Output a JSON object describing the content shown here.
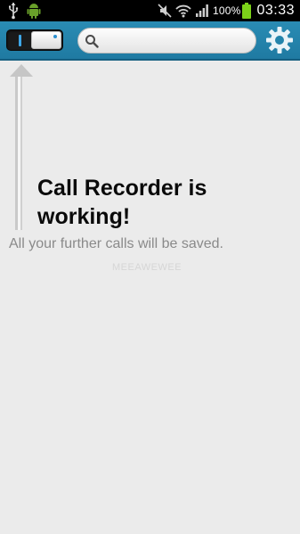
{
  "status_bar": {
    "battery_percent": "100%",
    "time": "03:33",
    "left_icons": [
      "usb-icon",
      "android-icon"
    ],
    "right_icons": [
      "mute-icon",
      "wifi-icon",
      "signal-icon",
      "battery-icon"
    ],
    "battery_level": 1.0,
    "battery_color": "#7cd319"
  },
  "action_bar": {
    "background_color": "#2585ad",
    "toggle": {
      "state": "on",
      "accent_color": "#3ea7e8"
    },
    "search": {
      "placeholder": "",
      "value": ""
    },
    "settings_icon": "gear-icon"
  },
  "content": {
    "headline": "Call Recorder is working!",
    "subtext": "All your further calls will be saved.",
    "watermark": "MEEAWEWEE",
    "guide_icon": "arrow-up-icon"
  }
}
